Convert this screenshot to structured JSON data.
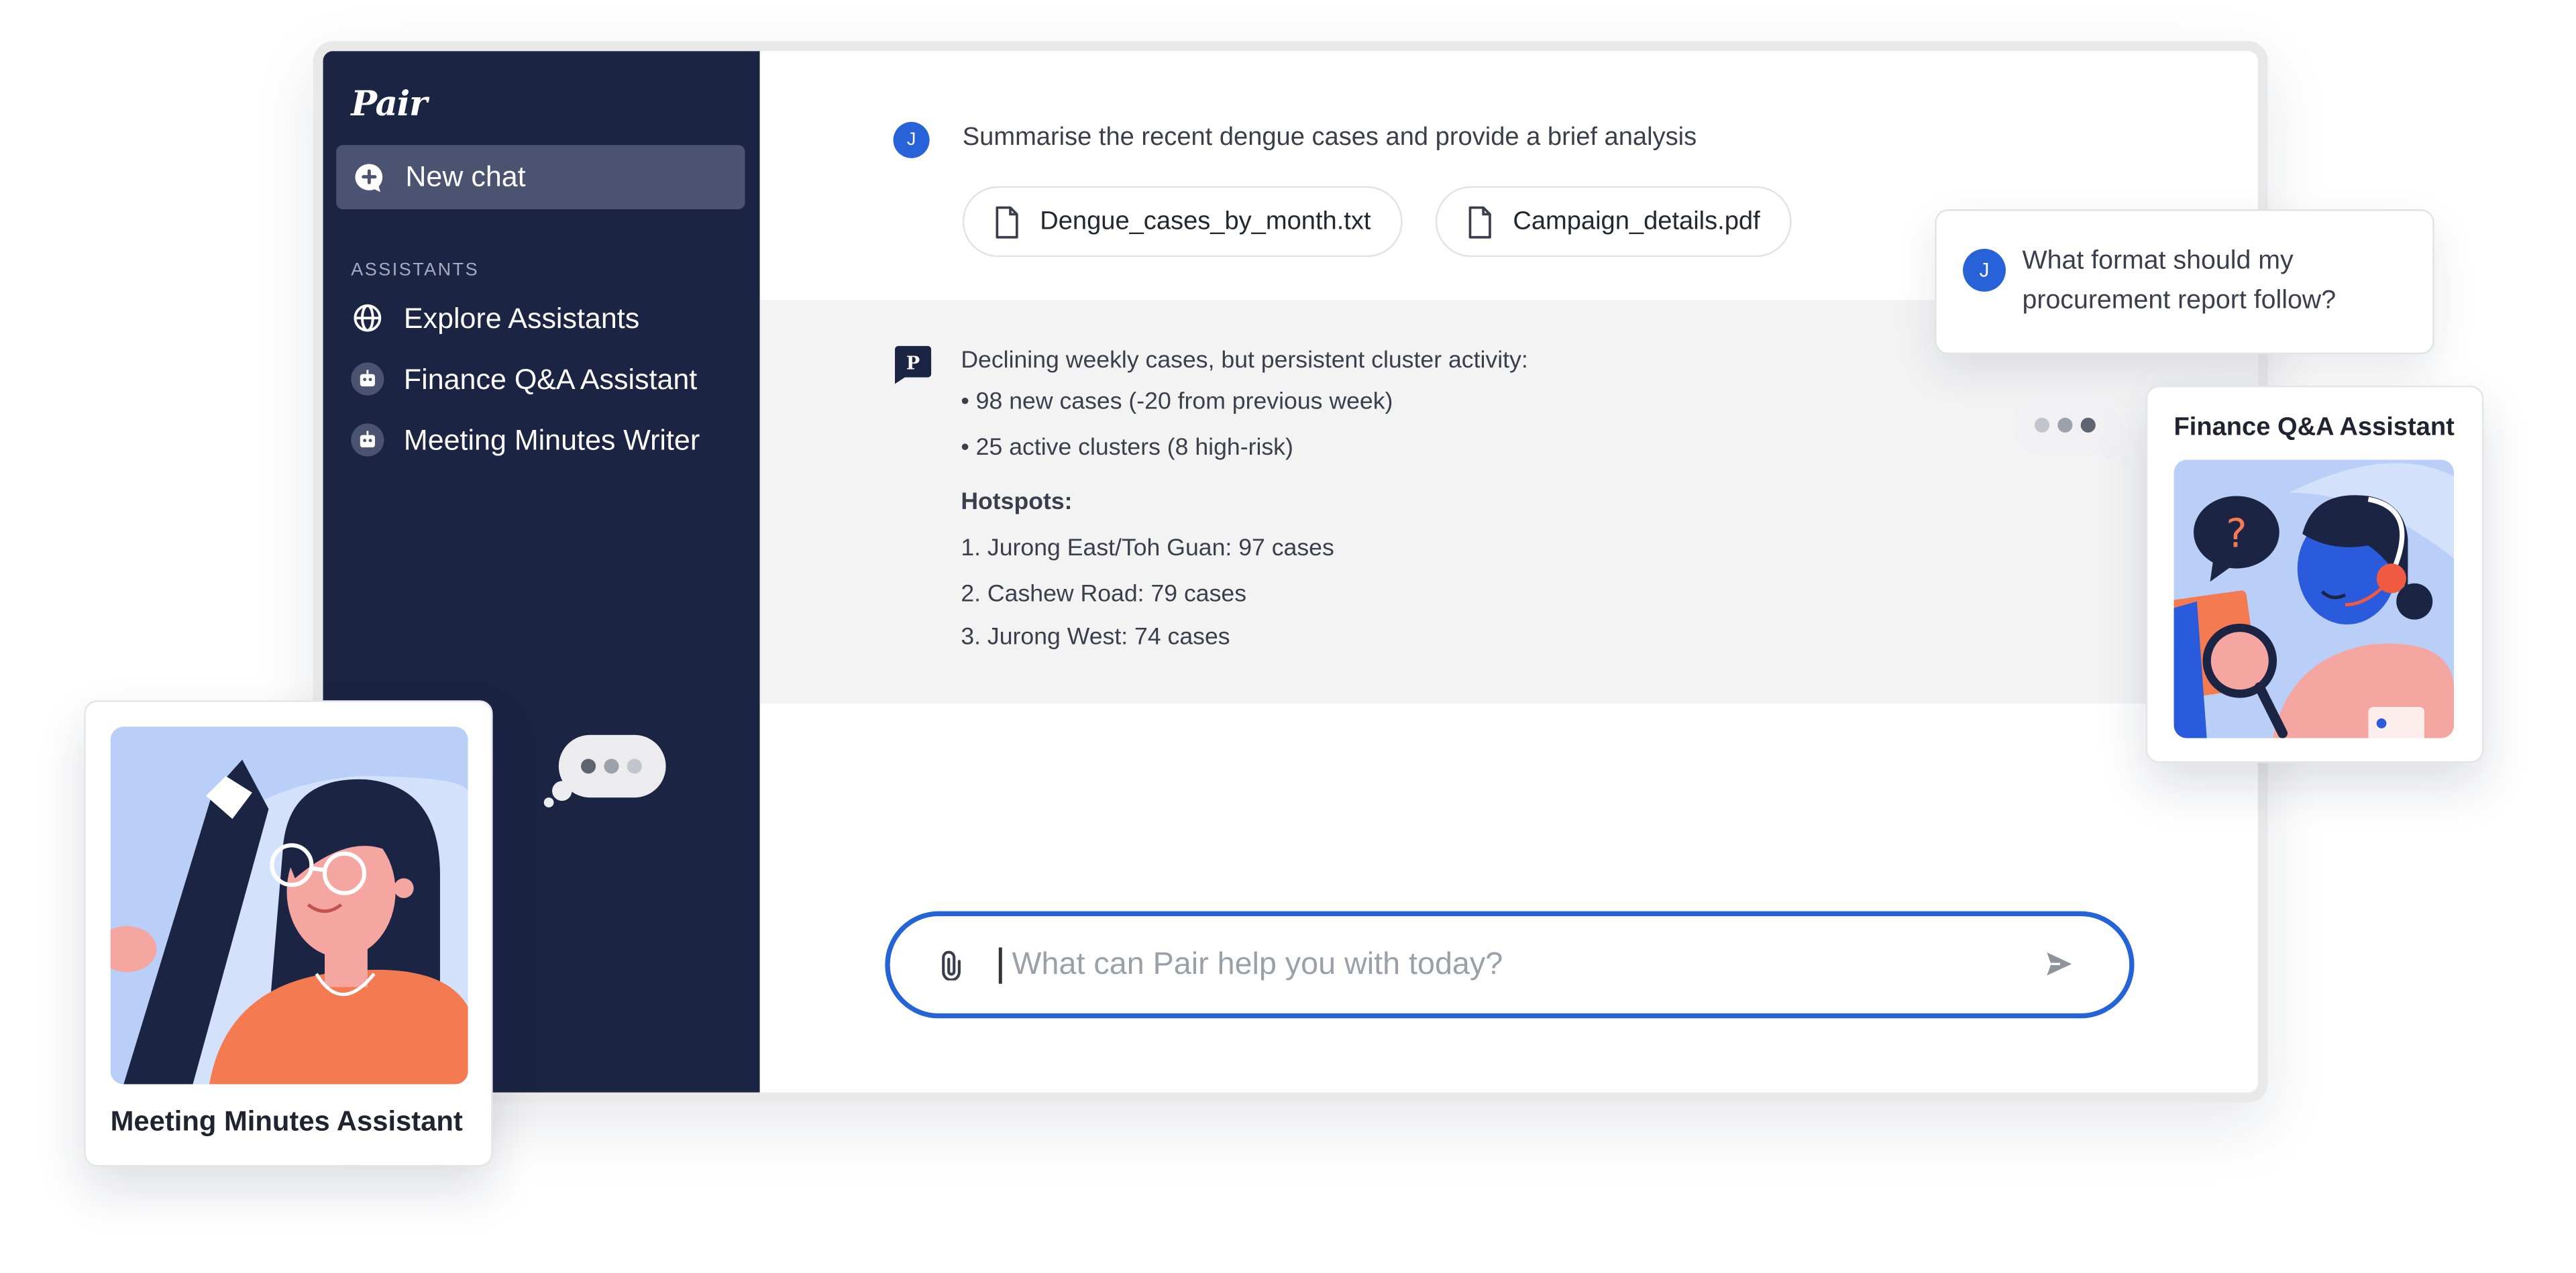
{
  "app": {
    "name": "Pair"
  },
  "sidebar": {
    "new_chat_label": "New chat",
    "section_title": "ASSISTANTS",
    "items": [
      {
        "label": "Explore Assistants",
        "icon": "globe-icon"
      },
      {
        "label": "Finance Q&A Assistant",
        "icon": "robot-icon"
      },
      {
        "label": "Meeting Minutes Writer",
        "icon": "robot-icon"
      }
    ]
  },
  "conversation": {
    "user": {
      "avatar_initial": "J",
      "message": "Summarise the recent dengue cases and provide a brief analysis",
      "attachments": [
        "Dengue_cases_by_month.txt",
        "Campaign_details.pdf"
      ]
    },
    "assistant": {
      "avatar_initial": "P",
      "lines": [
        "Declining weekly cases, but persistent cluster activity:",
        "• 98 new cases (-20 from previous week)",
        "• 25 active clusters (8 high-risk)",
        "Hotspots:",
        "1. Jurong East/Toh Guan: 97 cases",
        "2. Cashew Road: 79 cases",
        "3. Jurong West: 74 cases"
      ]
    }
  },
  "composer": {
    "placeholder": "What can Pair help you with today?"
  },
  "floating": {
    "question": {
      "avatar_initial": "J",
      "line1": "What format should my",
      "line2": "procurement report follow?"
    },
    "finance_card_title": "Finance Q&A Assistant",
    "minutes_card_title": "Meeting Minutes Assistant"
  },
  "colors": {
    "sidebar": "#1c2444",
    "accent": "#2563d9",
    "answer_bg": "#f3f3f4"
  }
}
